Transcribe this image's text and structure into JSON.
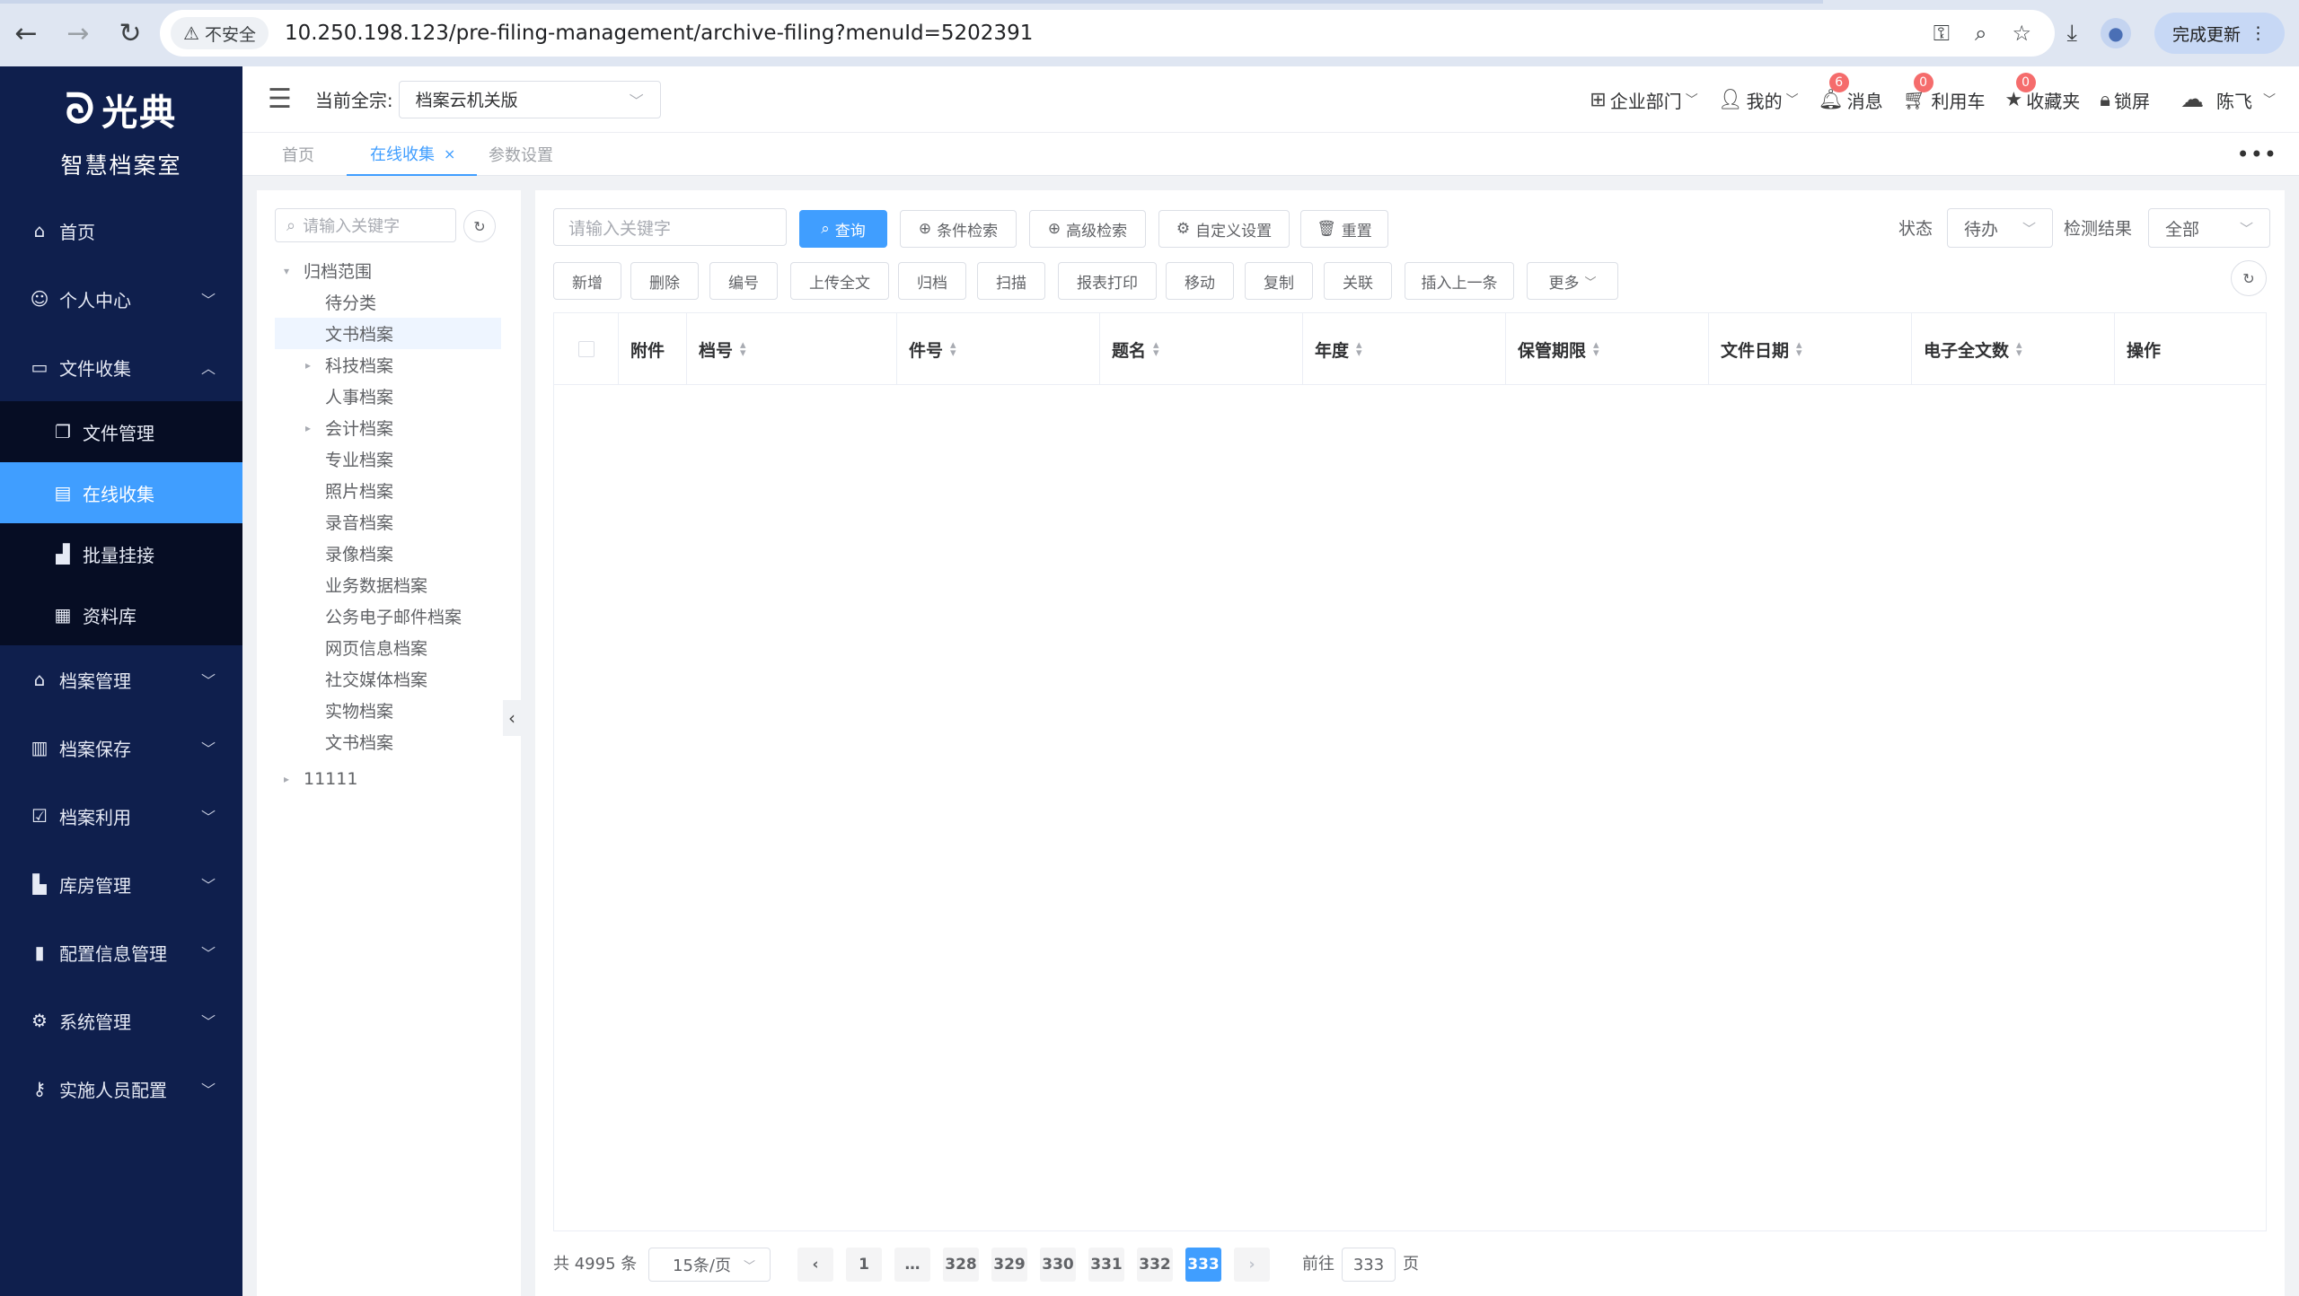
{
  "browser": {
    "security_label": "不安全",
    "url": "10.250.198.123/pre-filing-management/archive-filing?menuId=5202391",
    "update_label": "完成更新"
  },
  "sidebar": {
    "logo_text": "光典",
    "logo_subtitle": "智慧档案室",
    "items": [
      {
        "label": "首页",
        "icon": "home-icon"
      },
      {
        "label": "个人中心",
        "icon": "user-settings-icon"
      },
      {
        "label": "文件收集",
        "icon": "inbox-icon"
      },
      {
        "label": "档案管理",
        "icon": "bank-icon"
      },
      {
        "label": "档案保存",
        "icon": "building-icon"
      },
      {
        "label": "档案利用",
        "icon": "checklist-icon"
      },
      {
        "label": "库房管理",
        "icon": "office-icon"
      },
      {
        "label": "配置信息管理",
        "icon": "battery-icon"
      },
      {
        "label": "系统管理",
        "icon": "gear-icon"
      },
      {
        "label": "实施人员配置",
        "icon": "key-icon"
      }
    ],
    "sub_items": [
      {
        "label": "文件管理",
        "icon": "files-icon"
      },
      {
        "label": "在线收集",
        "icon": "document-icon"
      },
      {
        "label": "批量挂接",
        "icon": "bar-chart-icon"
      },
      {
        "label": "资料库",
        "icon": "calendar-icon"
      }
    ]
  },
  "header": {
    "qz_label": "当前全宗:",
    "qz_value": "档案云机关版",
    "dept": "企业部门",
    "mine": "我的",
    "messages": "消息",
    "messages_badge": "6",
    "cart": "利用车",
    "cart_badge": "0",
    "favorites": "收藏夹",
    "favorites_badge": "0",
    "lock": "锁屏",
    "user": "陈飞"
  },
  "tabs": [
    {
      "label": "首页"
    },
    {
      "label": "在线收集"
    },
    {
      "label": "参数设置"
    }
  ],
  "tree": {
    "search_placeholder": "请输入关键字",
    "nodes": [
      {
        "label": "归档范围"
      },
      {
        "label": "待分类"
      },
      {
        "label": "文书档案"
      },
      {
        "label": "科技档案"
      },
      {
        "label": "人事档案"
      },
      {
        "label": "会计档案"
      },
      {
        "label": "专业档案"
      },
      {
        "label": "照片档案"
      },
      {
        "label": "录音档案"
      },
      {
        "label": "录像档案"
      },
      {
        "label": "业务数据档案"
      },
      {
        "label": "公务电子邮件档案"
      },
      {
        "label": "网页信息档案"
      },
      {
        "label": "社交媒体档案"
      },
      {
        "label": "实物档案"
      },
      {
        "label": "文书档案"
      },
      {
        "label": "11111"
      }
    ]
  },
  "search": {
    "placeholder": "请输入关键字",
    "query": "查询",
    "condition": "条件检索",
    "advanced": "高级检索",
    "custom": "自定义设置",
    "reset": "重置",
    "status_label": "状态",
    "status_value": "待办",
    "check_label": "检测结果",
    "check_value": "全部"
  },
  "toolbar": [
    "新增",
    "删除",
    "编号",
    "上传全文",
    "归档",
    "扫描",
    "报表打印",
    "移动",
    "复制",
    "关联",
    "插入上一条",
    "更多"
  ],
  "table": {
    "columns": [
      "附件",
      "档号",
      "件号",
      "题名",
      "年度",
      "保管期限",
      "文件日期",
      "电子全文数",
      "操作"
    ]
  },
  "pagination": {
    "total": "共 4995 条",
    "page_size": "15条/页",
    "pages": [
      "1",
      "…",
      "328",
      "329",
      "330",
      "331",
      "332",
      "333"
    ],
    "current": "333",
    "goto_label": "前往",
    "goto_value": "333",
    "goto_suffix": "页"
  },
  "colors": {
    "sidebar_bg": "#0f1f4d",
    "accent": "#409eff",
    "badge": "#f56c6c"
  }
}
